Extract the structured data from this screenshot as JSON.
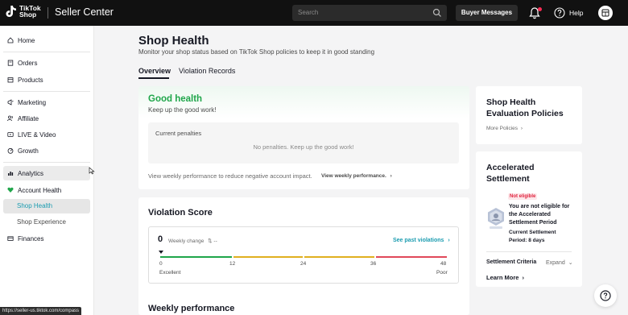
{
  "topbar": {
    "logo_line1": "TikTok",
    "logo_line2": "Shop",
    "app_title": "Seller Center",
    "search_placeholder": "Search",
    "buyer_messages": "Buyer Messages",
    "help": "Help"
  },
  "sidebar": {
    "items": [
      {
        "label": "Home",
        "icon": "home-icon"
      },
      {
        "label": "Orders",
        "icon": "orders-icon"
      },
      {
        "label": "Products",
        "icon": "products-icon"
      },
      {
        "label": "Marketing",
        "icon": "marketing-icon"
      },
      {
        "label": "Affiliate",
        "icon": "affiliate-icon"
      },
      {
        "label": "LIVE & Video",
        "icon": "live-video-icon"
      },
      {
        "label": "Growth",
        "icon": "growth-icon"
      },
      {
        "label": "Analytics",
        "icon": "analytics-icon"
      },
      {
        "label": "Account Health",
        "icon": "account-health-icon"
      },
      {
        "label": "Finances",
        "icon": "finances-icon"
      }
    ],
    "sub_items": [
      {
        "label": "Shop Health"
      },
      {
        "label": "Shop Experience"
      }
    ]
  },
  "status_url": "https://seller-us.tiktok.com/compass",
  "page": {
    "title": "Shop Health",
    "subtitle": "Monitor your shop status based on TikTok Shop policies to keep it in good standing",
    "tabs": [
      {
        "label": "Overview"
      },
      {
        "label": "Violation Records"
      }
    ]
  },
  "health": {
    "status": "Good health",
    "message": "Keep up the good work!",
    "penalties_title": "Current penalties",
    "penalties_message": "No penalties. Keep up the good work!",
    "weekly_note": "View weekly performance to reduce negative account impact.",
    "weekly_link": "View weekly performance."
  },
  "violation_score": {
    "title": "Violation Score",
    "score": "0",
    "weekly_change_label": "Weekly change",
    "weekly_change_value": "--",
    "see_past": "See past violations",
    "ticks": [
      "0",
      "12",
      "24",
      "36",
      "48"
    ],
    "scale_min_label": "Excellent",
    "scale_max_label": "Poor",
    "colors": {
      "excellent": "#1fa64a",
      "fair": "#e0b020",
      "poor": "#e0485a"
    }
  },
  "weekly_performance": {
    "title": "Weekly performance"
  },
  "policies": {
    "title": "Shop Health Evaluation Policies",
    "link": "More Policies"
  },
  "settlement": {
    "title": "Accelerated Settlement",
    "badge": "Not eligible",
    "description": "You are not eligible for the Accelerated Settlement Period",
    "current_label": "Current Settlement",
    "current_value": "Period: 8 days",
    "criteria_label": "Settlement Criteria",
    "expand": "Expand",
    "learn_more": "Learn More"
  },
  "colors": {
    "accent": "#1b9cb0",
    "good": "#1fa64a",
    "danger": "#e0243f"
  }
}
